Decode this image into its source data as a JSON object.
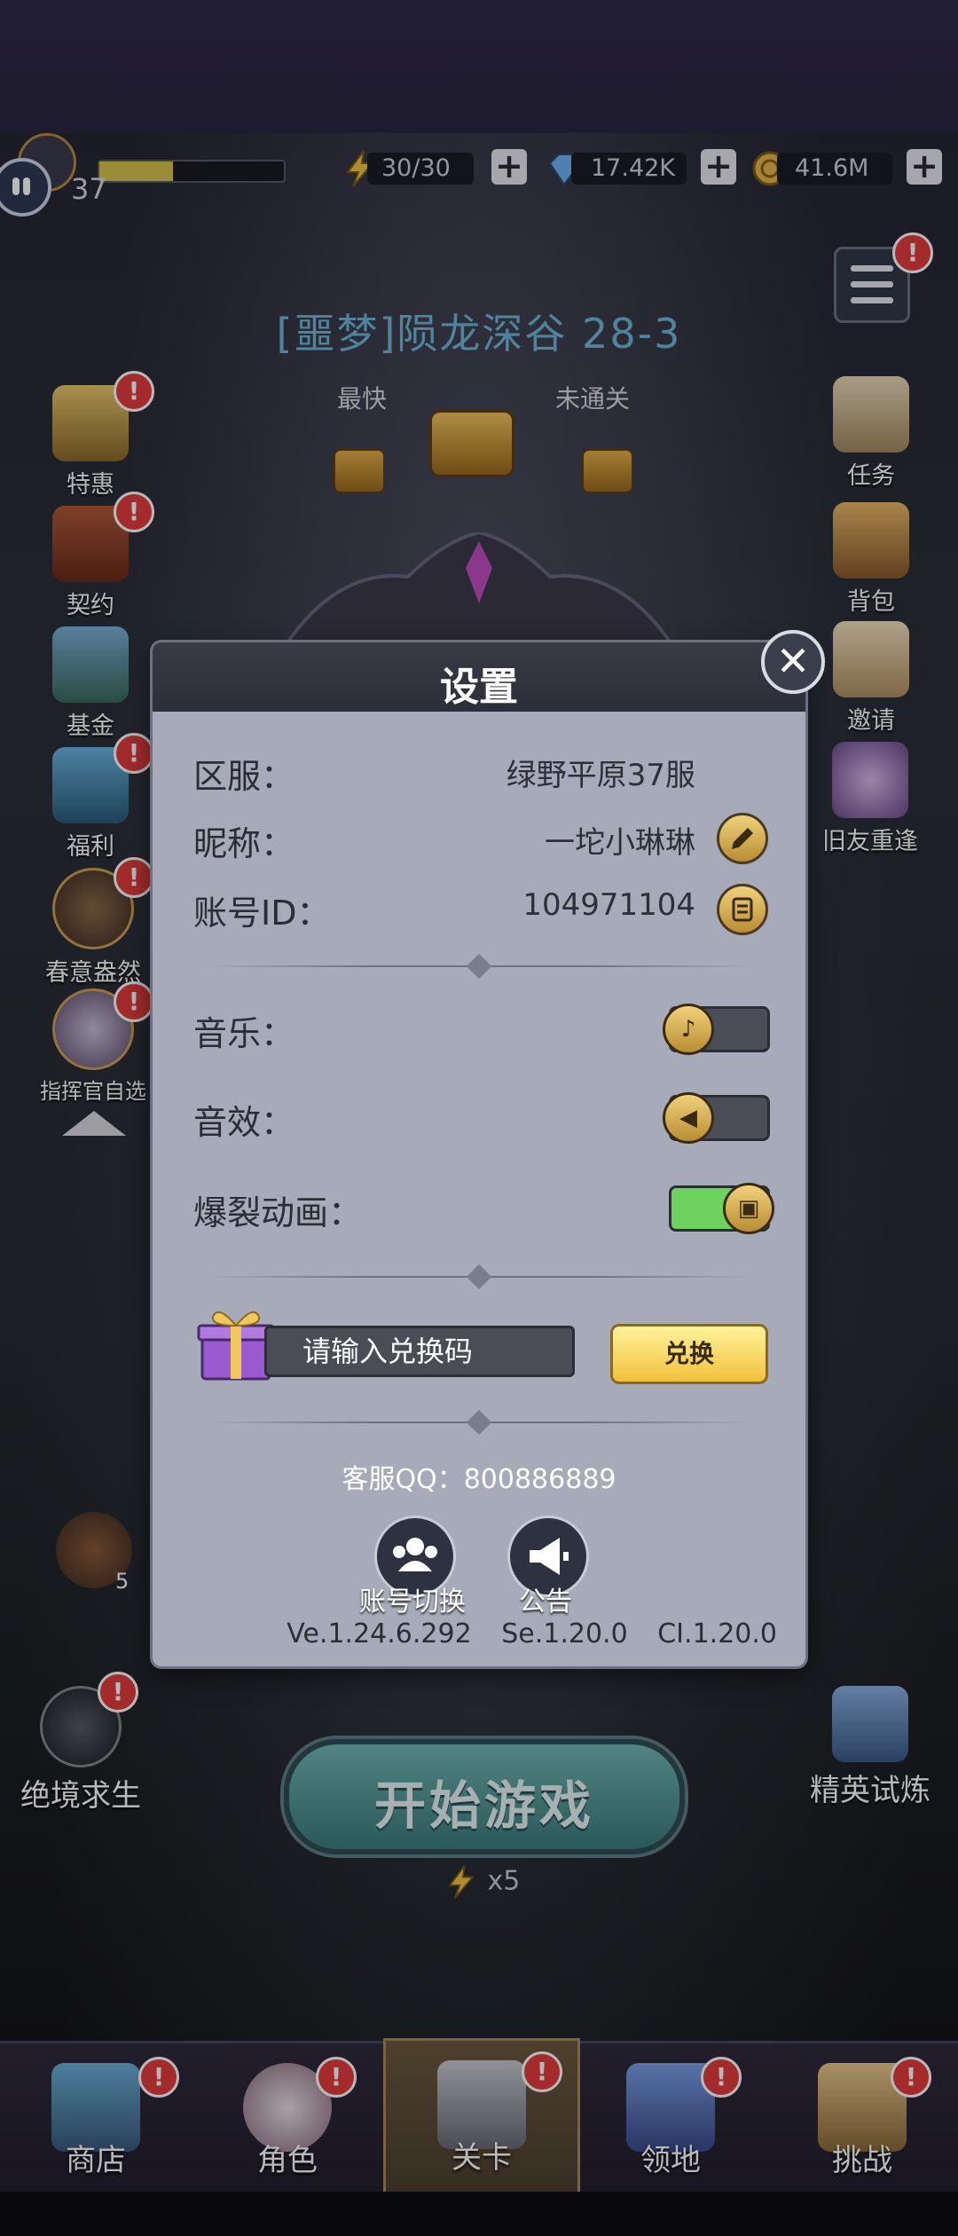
{
  "hud": {
    "level": "37",
    "xp_fraction": 0.4,
    "energy": "30/30",
    "gems": "17.42K",
    "gold": "41.6M",
    "plus": "+"
  },
  "stage": {
    "title": "[噩梦]陨龙深谷 28-3",
    "best_prefix": "最快",
    "not_cleared": "未通关"
  },
  "left_menu": [
    {
      "label": "特惠",
      "badge": "!"
    },
    {
      "label": "契约",
      "badge": "!"
    },
    {
      "label": "基金",
      "badge": ""
    },
    {
      "label": "福利",
      "badge": "!"
    },
    {
      "label": "春意盎然",
      "badge": "!"
    },
    {
      "label": "指挥官自选",
      "badge": "!"
    }
  ],
  "right_menu": [
    {
      "label": "任务"
    },
    {
      "label": "背包"
    },
    {
      "label": "邀请"
    },
    {
      "label": "旧友重逢"
    }
  ],
  "lower": {
    "survival_label": "绝境求生",
    "elite_label": "精英试炼",
    "start_label": "开始游戏",
    "energy_cost": "x5",
    "chest_count": "5"
  },
  "bottom_nav": [
    {
      "label": "商店",
      "badge": "!"
    },
    {
      "label": "角色",
      "badge": "!"
    },
    {
      "label": "关卡",
      "badge": "!"
    },
    {
      "label": "领地",
      "badge": "!"
    },
    {
      "label": "挑战",
      "badge": "!"
    }
  ],
  "settings": {
    "title": "设置",
    "close": "✕",
    "server_label": "区服：",
    "server_value": "绿野平原37服",
    "nickname_label": "昵称：",
    "nickname_value": "一坨小琳琳",
    "account_label": "账号ID：",
    "account_value": "104971104",
    "music_label": "音乐：",
    "music_on": false,
    "sfx_label": "音效：",
    "sfx_on": false,
    "burst_label": "爆裂动画：",
    "burst_on": true,
    "code_placeholder": "请输入兑换码",
    "redeem_label": "兑换",
    "qq_label": "客服QQ：800886889",
    "switch_account_label": "账号切换",
    "notice_label": "公告",
    "version_ve": "Ve.1.24.6.292",
    "version_se": "Se.1.20.0",
    "version_ci": "CI.1.20.0"
  }
}
